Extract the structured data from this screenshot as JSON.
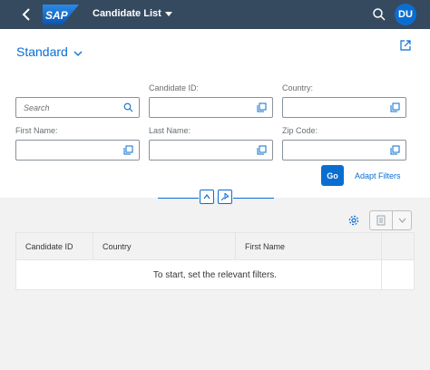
{
  "shell": {
    "logo_text": "SAP",
    "app_title": "Candidate List",
    "avatar_initials": "DU"
  },
  "filterbar": {
    "variant": "Standard",
    "search": {
      "placeholder": "Search",
      "value": ""
    },
    "fields": [
      {
        "label": "Candidate ID:",
        "value": ""
      },
      {
        "label": "Country:",
        "value": ""
      },
      {
        "label": "First Name:",
        "value": ""
      },
      {
        "label": "Last Name:",
        "value": ""
      },
      {
        "label": "Zip Code:",
        "value": ""
      }
    ],
    "go_label": "Go",
    "adapt_label": "Adapt Filters"
  },
  "table": {
    "columns": [
      "Candidate ID",
      "Country",
      "First Name"
    ],
    "empty_text": "To start, set the relevant filters."
  },
  "colors": {
    "shell": "#354a5f",
    "accent": "#0a6ed1",
    "background": "#f2f2f2"
  }
}
